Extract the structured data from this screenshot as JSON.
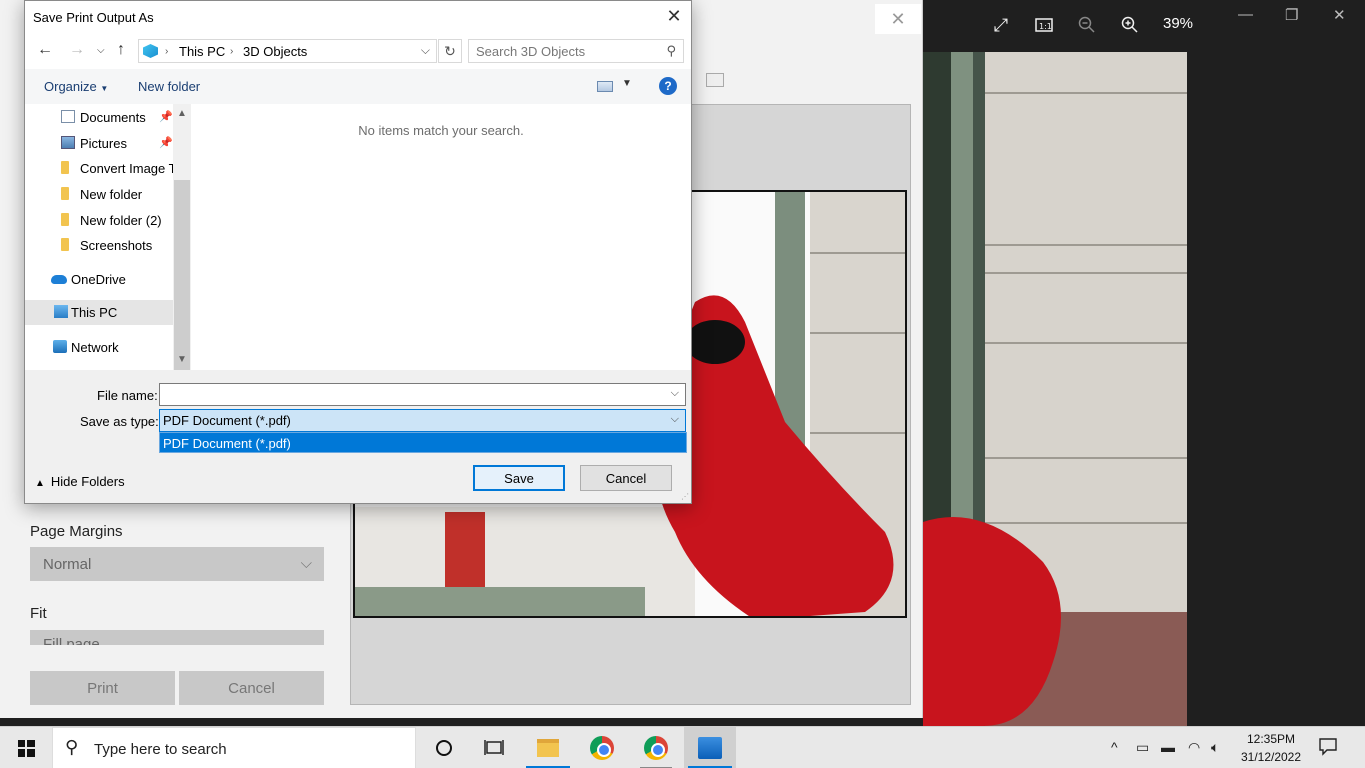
{
  "viewer": {
    "zoom_level": "39%",
    "close_glyph": "✕"
  },
  "print_dialog": {
    "page_margins_label": "Page Margins",
    "page_margins_value": "Normal",
    "fit_label": "Fit",
    "fit_value": "Fill page",
    "print_label": "Print",
    "cancel_label": "Cancel"
  },
  "save_dialog": {
    "title": "Save Print Output As",
    "address": {
      "segment1": "This PC",
      "segment2": "3D Objects"
    },
    "search_placeholder": "Search 3D Objects",
    "toolbar": {
      "organize_label": "Organize",
      "new_folder_label": "New folder",
      "help_label": "?"
    },
    "tree": [
      {
        "label": "Documents",
        "pinned": true
      },
      {
        "label": "Pictures",
        "pinned": true
      },
      {
        "label": "Convert Image To",
        "pinned": false
      },
      {
        "label": "New folder",
        "pinned": false
      },
      {
        "label": "New folder (2)",
        "pinned": false
      },
      {
        "label": "Screenshots",
        "pinned": false
      },
      {
        "label": "OneDrive",
        "pinned": false
      },
      {
        "label": "This PC",
        "pinned": false,
        "selected": true
      },
      {
        "label": "Network",
        "pinned": false
      }
    ],
    "empty_message": "No items match your search.",
    "file_name_label": "File name:",
    "file_name_value": "",
    "save_as_type_label": "Save as type:",
    "save_as_type_value": "PDF Document (*.pdf)",
    "save_as_type_options": [
      "PDF Document (*.pdf)"
    ],
    "hide_folders_label": "Hide Folders",
    "save_label": "Save",
    "cancel_label": "Cancel"
  },
  "taskbar": {
    "search_placeholder": "Type here to search",
    "time": "12:35PM",
    "date": "31/12/2022"
  }
}
